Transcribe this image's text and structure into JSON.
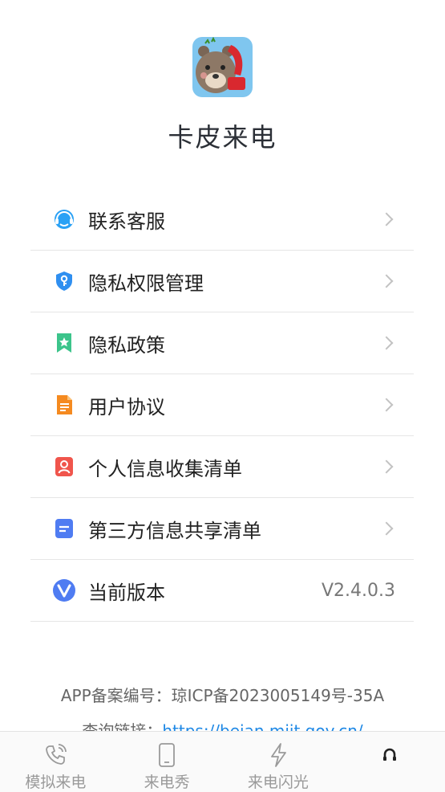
{
  "app": {
    "name": "卡皮来电",
    "logo_icon": "capybara-phone-logo"
  },
  "menu": [
    {
      "label": "联系客服",
      "icon": "customer-service-icon",
      "color": "#2aa1f5"
    },
    {
      "label": "隐私权限管理",
      "icon": "shield-key-icon",
      "color": "#2f8ff0"
    },
    {
      "label": "隐私政策",
      "icon": "bookmark-star-icon",
      "color": "#3cc48b"
    },
    {
      "label": "用户协议",
      "icon": "document-icon",
      "color": "#f58a20"
    },
    {
      "label": "个人信息收集清单",
      "icon": "person-card-icon",
      "color": "#f0554c"
    },
    {
      "label": "第三方信息共享清单",
      "icon": "list-document-icon",
      "color": "#4f7cf2"
    },
    {
      "label": "当前版本",
      "icon": "version-v-icon",
      "color": "#4f7cf2",
      "value": "V2.4.0.3"
    }
  ],
  "footer": {
    "icp": "APP备案编号：琼ICP备2023005149号-35A",
    "query_label": "查询链接：",
    "query_link": "https://beian.miit.gov.cn/"
  },
  "tabs": [
    {
      "label": "模拟来电",
      "icon": "phone-ring-icon"
    },
    {
      "label": "来电秀",
      "icon": "phone-device-icon"
    },
    {
      "label": "来电闪光",
      "icon": "lightning-icon"
    },
    {
      "label": "",
      "icon": "headphones-icon"
    }
  ],
  "colors": {
    "tab_inactive": "#9a9a9a",
    "tab_active": "#222222",
    "link": "#1e88e5"
  }
}
